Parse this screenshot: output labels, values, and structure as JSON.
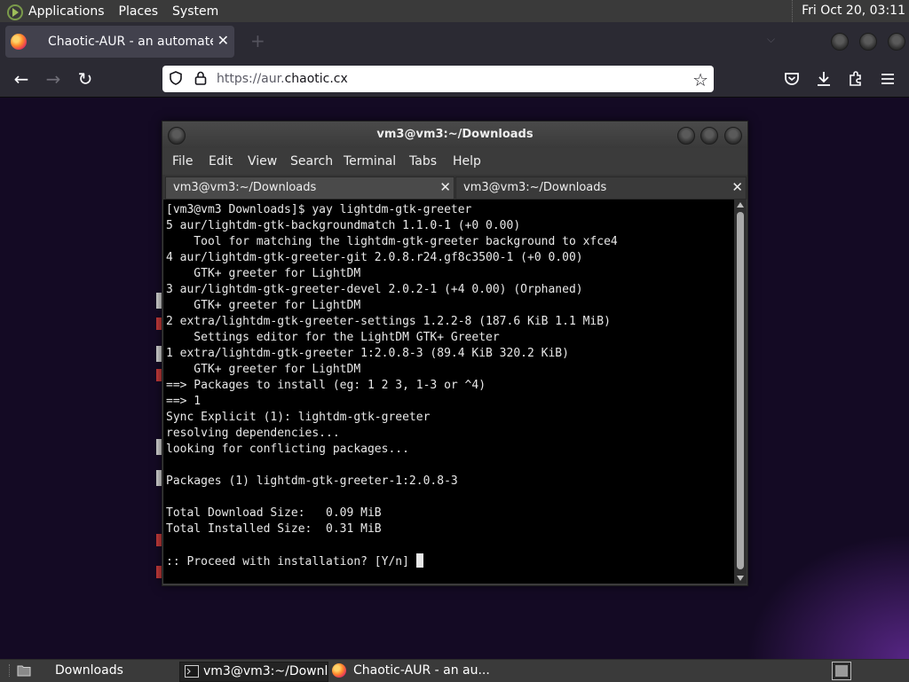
{
  "top_panel": {
    "menus": [
      "Applications",
      "Places",
      "System"
    ],
    "clock": "Fri Oct 20, 03:11"
  },
  "browser": {
    "tab_title": "Chaotic-AUR - an automated bu",
    "url_prefix": "https://aur.",
    "url_domain": "chaotic.cx"
  },
  "terminal": {
    "title": "vm3@vm3:~/Downloads",
    "menu": [
      "File",
      "Edit",
      "View",
      "Search",
      "Terminal",
      "Tabs",
      "Help"
    ],
    "tabs": [
      "vm3@vm3:~/Downloads",
      "vm3@vm3:~/Downloads"
    ],
    "lines": [
      "[vm3@vm3 Downloads]$ yay lightdm-gtk-greeter",
      "5 aur/lightdm-gtk-backgroundmatch 1.1.0-1 (+0 0.00)",
      "    Tool for matching the lightdm-gtk-greeter background to xfce4",
      "4 aur/lightdm-gtk-greeter-git 2.0.8.r24.gf8c3500-1 (+0 0.00)",
      "    GTK+ greeter for LightDM",
      "3 aur/lightdm-gtk-greeter-devel 2.0.2-1 (+4 0.00) (Orphaned)",
      "    GTK+ greeter for LightDM",
      "2 extra/lightdm-gtk-greeter-settings 1.2.2-8 (187.6 KiB 1.1 MiB)",
      "    Settings editor for the LightDM GTK+ Greeter",
      "1 extra/lightdm-gtk-greeter 1:2.0.8-3 (89.4 KiB 320.2 KiB)",
      "    GTK+ greeter for LightDM",
      "==> Packages to install (eg: 1 2 3, 1-3 or ^4)",
      "==> 1",
      "Sync Explicit (1): lightdm-gtk-greeter",
      "resolving dependencies...",
      "looking for conflicting packages...",
      "",
      "Packages (1) lightdm-gtk-greeter-1:2.0.8-3",
      "",
      "Total Download Size:   0.09 MiB",
      "Total Installed Size:  0.31 MiB",
      ""
    ],
    "prompt": ":: Proceed with installation? [Y/n] "
  },
  "taskbar": {
    "items": [
      "Downloads",
      "vm3@vm3:~/Downl...",
      "Chaotic-AUR - an au..."
    ]
  }
}
